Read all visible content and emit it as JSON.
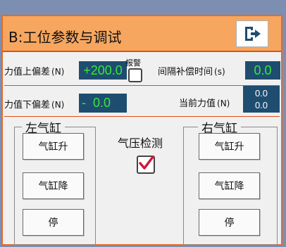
{
  "window": {
    "title": "B:工位参数与调试",
    "exit_icon": "exit-icon"
  },
  "params": {
    "upper_dev_label": "力值上偏差",
    "upper_dev_unit": "(N)",
    "upper_dev_value": "+200.0",
    "alarm_label": "报警",
    "alarm_checked": false,
    "interval_label": "间隔补偿时间",
    "interval_unit": "(s)",
    "interval_value": "0.0",
    "lower_dev_label": "力值下偏差",
    "lower_dev_unit": "(N)",
    "lower_dev_value": "-  0.0",
    "current_label": "当前力值",
    "current_unit": "(N)",
    "current_value_1": "0.0",
    "current_value_2": "0.0"
  },
  "left_cylinder": {
    "title": "左气缸",
    "up_label": "气缸升",
    "down_label": "气缸降",
    "stop_label": "停"
  },
  "pressure": {
    "label": "气压检测",
    "checked": true
  },
  "right_cylinder": {
    "title": "右气缸",
    "up_label": "气缸升",
    "down_label": "气缸降",
    "stop_label": "停"
  },
  "colors": {
    "title_bg": "#f6a65f",
    "border": "#e36a2a",
    "value_bg": "#1e4d70",
    "value_text": "#38e83a",
    "check_mark": "#d4163c"
  }
}
